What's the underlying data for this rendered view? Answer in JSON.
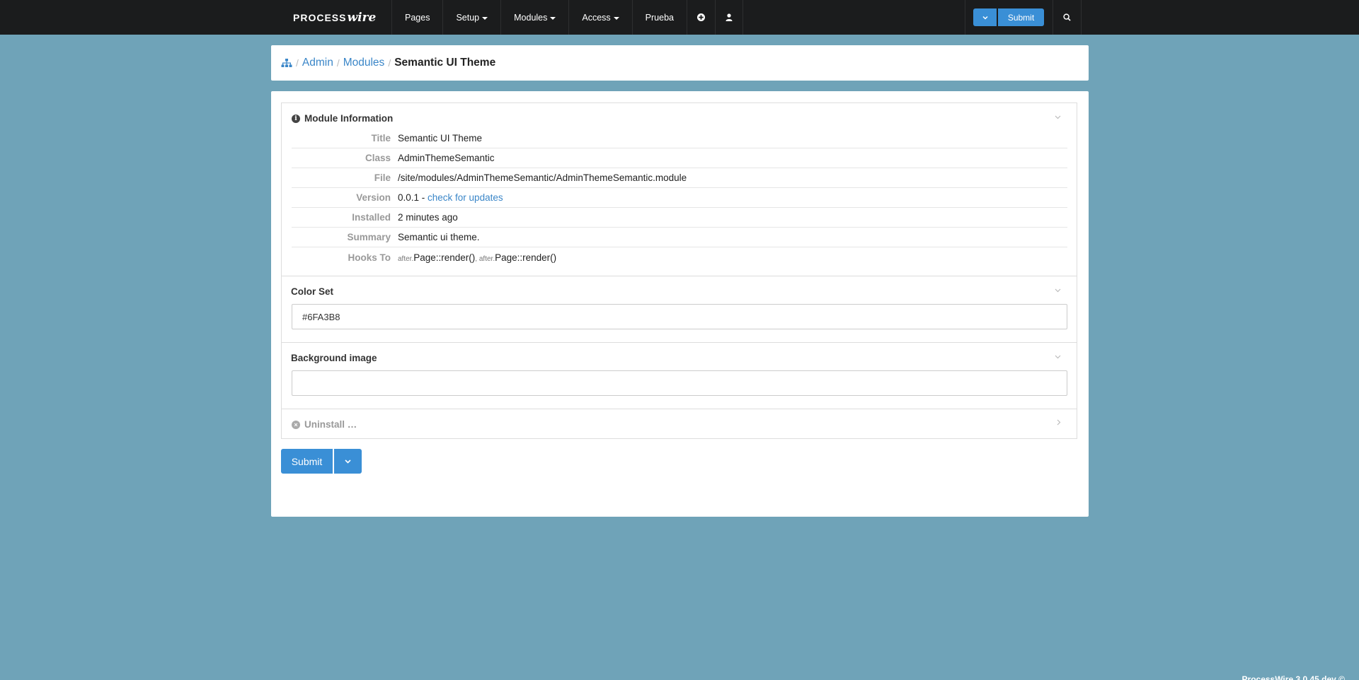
{
  "nav": {
    "logo_process": "PROCESS",
    "logo_wire": "wire",
    "items": [
      {
        "label": "Pages",
        "dropdown": false
      },
      {
        "label": "Setup",
        "dropdown": true
      },
      {
        "label": "Modules",
        "dropdown": true
      },
      {
        "label": "Access",
        "dropdown": true
      },
      {
        "label": "Prueba",
        "dropdown": false
      }
    ],
    "add_icon": "plus-circle-icon",
    "user_icon": "user-icon",
    "submit_label": "Submit",
    "search_icon": "search-icon"
  },
  "breadcrumb": {
    "home_icon": "sitemap-icon",
    "items": [
      "Admin",
      "Modules"
    ],
    "current": "Semantic UI Theme"
  },
  "module_info": {
    "heading": "Module Information",
    "rows": {
      "title": {
        "label": "Title",
        "value": "Semantic UI Theme"
      },
      "class": {
        "label": "Class",
        "value": "AdminThemeSemantic"
      },
      "file": {
        "label": "File",
        "value": "/site/modules/AdminThemeSemantic/AdminThemeSemantic.module"
      },
      "version": {
        "label": "Version",
        "value": "0.0.1 - ",
        "link": "check for updates"
      },
      "installed": {
        "label": "Installed",
        "value": "2 minutes ago"
      },
      "summary": {
        "label": "Summary",
        "value": "Semantic ui theme."
      },
      "hooks": {
        "label": "Hooks To",
        "prefix1": "after.",
        "hook1": "Page::render()",
        "sep": ", ",
        "prefix2": "after.",
        "hook2": "Page::render()"
      }
    }
  },
  "color_set": {
    "label": "Color Set",
    "value": "#6FA3B8"
  },
  "background_image": {
    "label": "Background image",
    "value": ""
  },
  "uninstall": {
    "label": "Uninstall …"
  },
  "form": {
    "submit_label": "Submit"
  },
  "footer": {
    "text": "ProcessWire 3.0.45 dev ©"
  },
  "colors": {
    "background": "#6FA3B8",
    "topbar": "#1b1c1d",
    "accent": "#3a8fd6",
    "link": "#3a86c8"
  }
}
